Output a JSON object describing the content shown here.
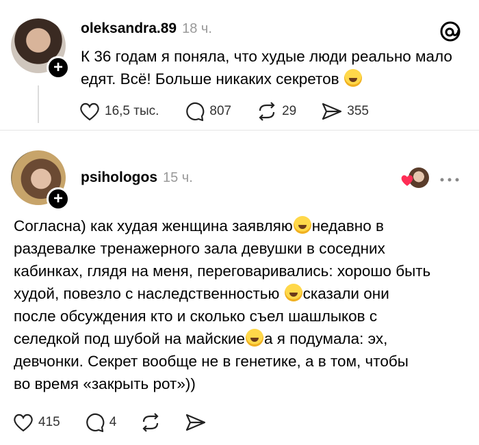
{
  "post1": {
    "username": "oleksandra.89",
    "time": "18 ч.",
    "text": "К 36 годам я поняла, что худые люди реально мало едят. Всё! Больше никаких секретов",
    "likes": "16,5 тыс.",
    "replies": "807",
    "reposts": "29",
    "shares": "355"
  },
  "post2": {
    "username": "psihologos",
    "time": "15 ч.",
    "lines": [
      "Согласна) как худая женщина заявляю",
      "недавно в",
      "раздевалке тренажерного зала девушки в соседних",
      "кабинках, глядя на меня, переговаривались: хорошо быть",
      "худой, повезло с наследственностью",
      "сказали они",
      "после обсуждения кто и сколько съел шашлыков с",
      "селедкой под шубой на майские",
      "а я подумала: эх,",
      "девчонки. Секрет вообще не в генетике, а в том, чтобы",
      "во время «закрыть рот»))"
    ],
    "likes": "415",
    "replies": "4"
  },
  "icons": {
    "threads": "threads-logo-icon",
    "heart": "heart-icon",
    "reply": "comment-icon",
    "repost": "repost-icon",
    "share": "share-icon",
    "more": "more-icon"
  }
}
